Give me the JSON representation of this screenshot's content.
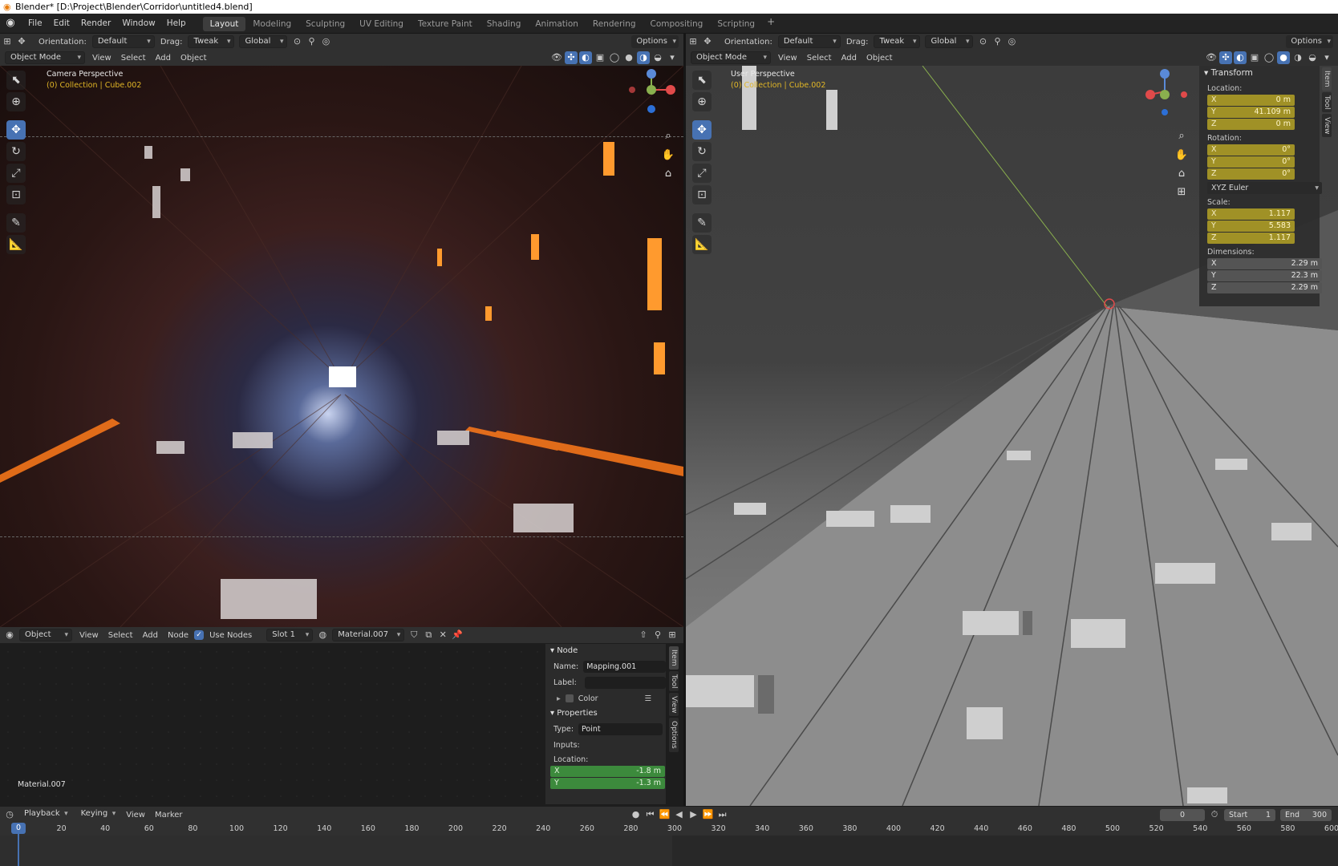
{
  "window_title": "Blender* [D:\\Project\\Blender\\Corridor\\untitled4.blend]",
  "menu": [
    "File",
    "Edit",
    "Render",
    "Window",
    "Help"
  ],
  "workspaces": [
    "Layout",
    "Modeling",
    "Sculpting",
    "UV Editing",
    "Texture Paint",
    "Shading",
    "Animation",
    "Rendering",
    "Compositing",
    "Scripting"
  ],
  "active_workspace": "Layout",
  "tool_settings": {
    "orientation_label": "Orientation:",
    "orientation_value": "Default",
    "drag_label": "Drag:",
    "drag_value": "Tweak",
    "transform_value": "Global",
    "options": "Options"
  },
  "left_view": {
    "mode": "Object Mode",
    "menus": [
      "View",
      "Select",
      "Add",
      "Object"
    ],
    "perspective": "Camera Perspective",
    "collection": "(0) Collection | Cube.002"
  },
  "right_view": {
    "mode": "Object Mode",
    "menus": [
      "View",
      "Select",
      "Add",
      "Object"
    ],
    "perspective": "User Perspective",
    "collection": "(0) Collection | Cube.002"
  },
  "transform_panel": {
    "title": "Transform",
    "location_label": "Location:",
    "location": [
      {
        "axis": "X",
        "value": "0 m"
      },
      {
        "axis": "Y",
        "value": "41.109 m"
      },
      {
        "axis": "Z",
        "value": "0 m"
      }
    ],
    "rotation_label": "Rotation:",
    "rotation": [
      {
        "axis": "X",
        "value": "0°"
      },
      {
        "axis": "Y",
        "value": "0°"
      },
      {
        "axis": "Z",
        "value": "0°"
      }
    ],
    "rotation_mode": "XYZ Euler",
    "scale_label": "Scale:",
    "scale": [
      {
        "axis": "X",
        "value": "1.117"
      },
      {
        "axis": "Y",
        "value": "5.583"
      },
      {
        "axis": "Z",
        "value": "1.117"
      }
    ],
    "dimensions_label": "Dimensions:",
    "dimensions": [
      {
        "axis": "X",
        "value": "2.29 m"
      },
      {
        "axis": "Y",
        "value": "22.3 m"
      },
      {
        "axis": "Z",
        "value": "2.29 m"
      }
    ],
    "side_tabs": [
      "Item",
      "Tool",
      "View"
    ]
  },
  "node_editor": {
    "type": "Object",
    "menus": [
      "View",
      "Select",
      "Add",
      "Node"
    ],
    "use_nodes_label": "Use Nodes",
    "slot": "Slot 1",
    "material": "Material.007",
    "canvas_label": "Material.007",
    "panel": {
      "node_title": "Node",
      "name_label": "Name:",
      "name_value": "Mapping.001",
      "label_label": "Label:",
      "label_value": "",
      "color_label": "Color",
      "properties_title": "Properties",
      "type_label": "Type:",
      "type_value": "Point",
      "inputs_label": "Inputs:",
      "location_label": "Location:",
      "location": [
        {
          "axis": "X",
          "value": "-1.8 m"
        },
        {
          "axis": "Y",
          "value": "-1.3 m"
        }
      ]
    },
    "side_tabs": [
      "Item",
      "Tool",
      "View",
      "Options"
    ]
  },
  "timeline": {
    "menus": [
      "Playback",
      "Keying",
      "View",
      "Marker"
    ],
    "current_frame": "0",
    "start_label": "Start",
    "start": "1",
    "end_label": "End",
    "end": "300",
    "ticks": [
      "0",
      "20",
      "40",
      "60",
      "80",
      "100",
      "120",
      "140",
      "160",
      "180",
      "200",
      "220",
      "240",
      "260",
      "280",
      "300",
      "320",
      "340",
      "360",
      "380",
      "400",
      "420",
      "440",
      "460",
      "480",
      "500",
      "520",
      "540",
      "560",
      "580",
      "600"
    ]
  },
  "colors": {
    "accent_blue": "#4772b3",
    "field_yellow": "#a09126",
    "field_green": "#3c8a3c",
    "collection_text": "#e1b626"
  }
}
